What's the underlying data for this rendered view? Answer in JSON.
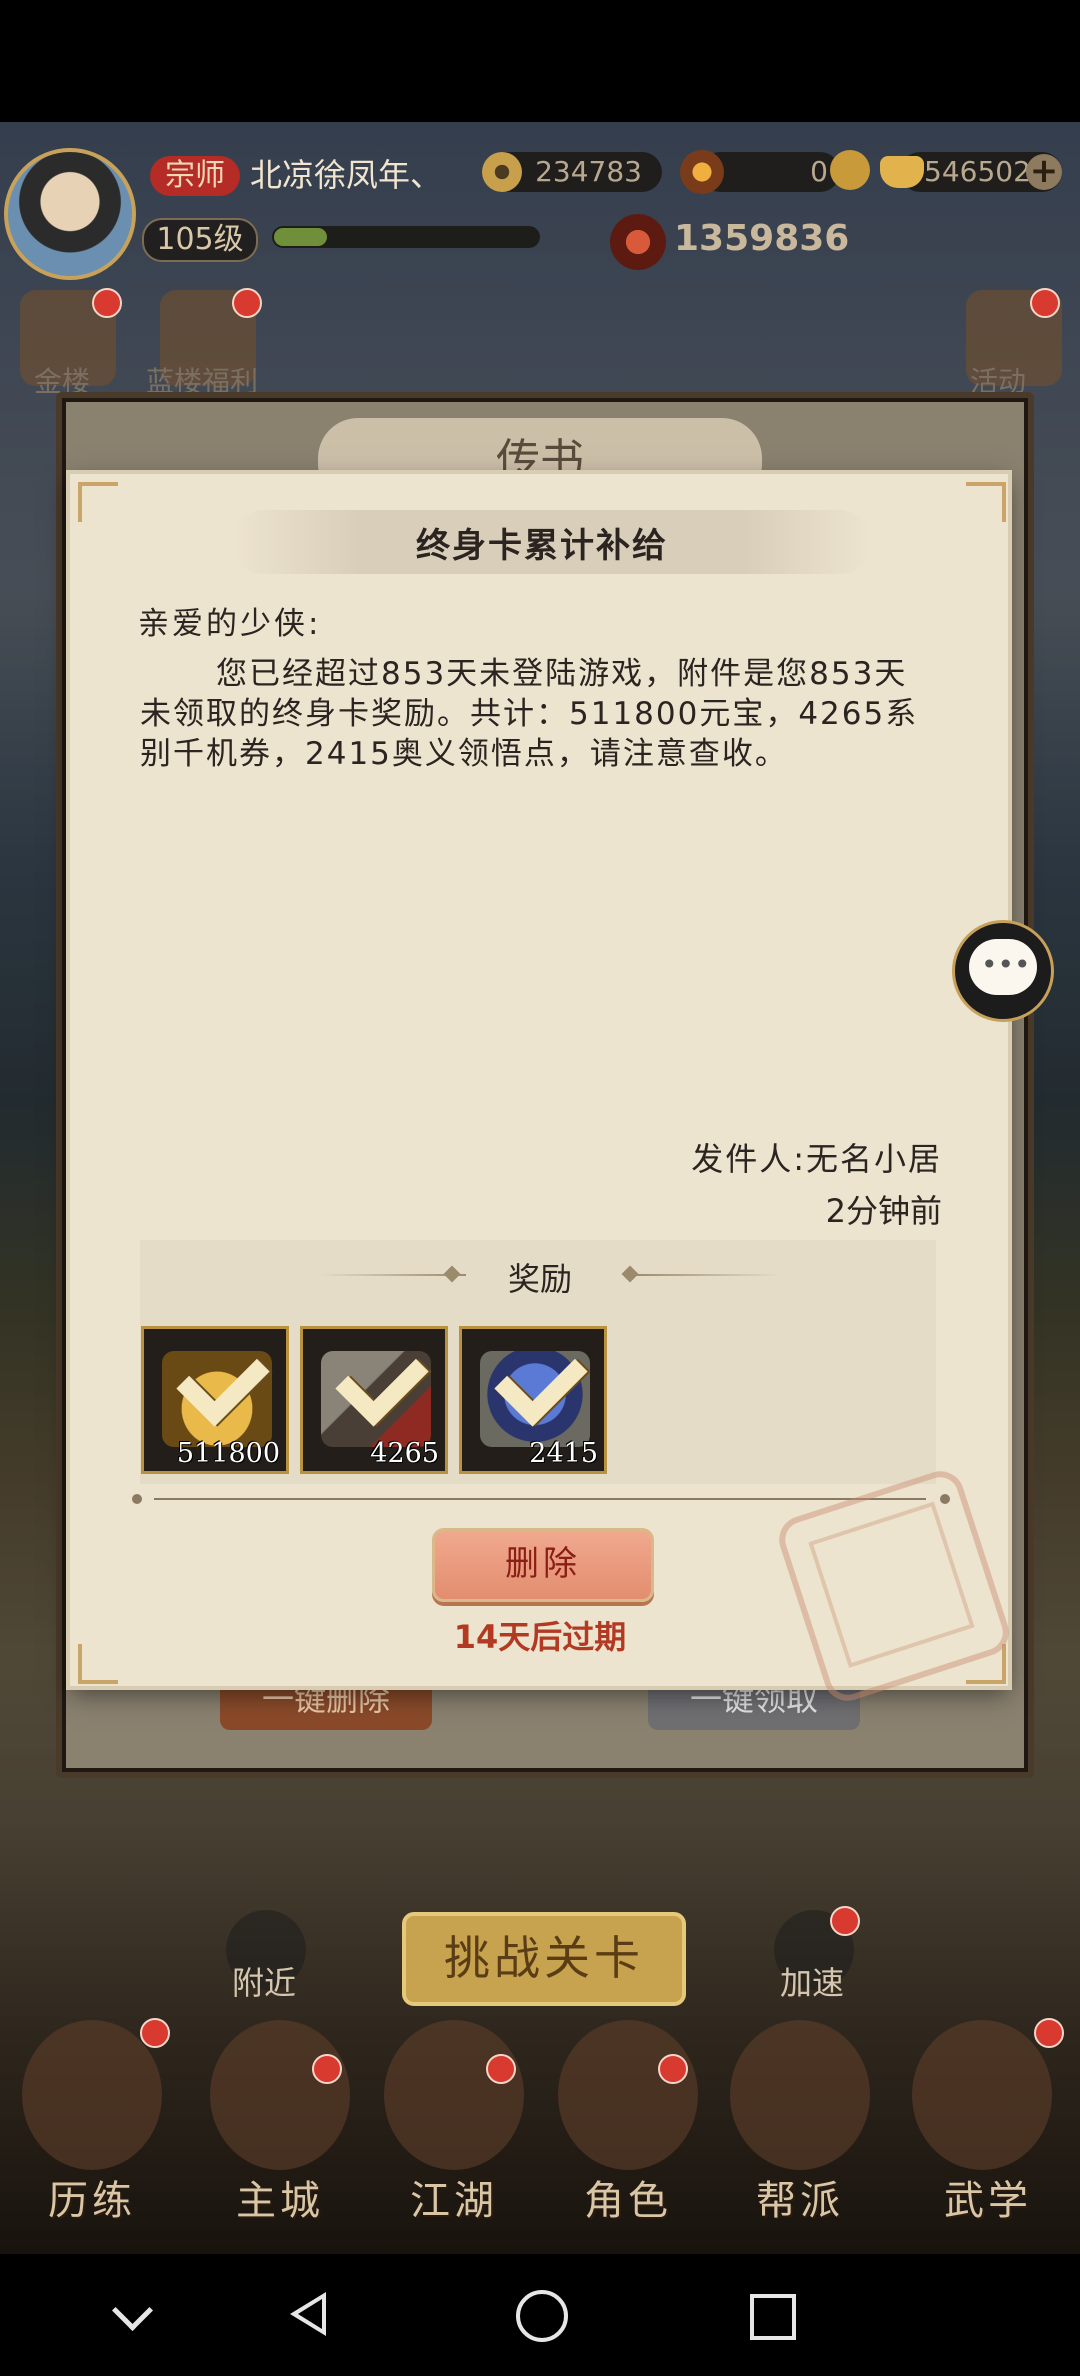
{
  "hud": {
    "rank": "宗师",
    "player_name": "北凉徐凤年、",
    "coins": "234783",
    "stamina": "0",
    "gold": "546502",
    "level": "105级",
    "exp_fraction": 0.2,
    "power": "1359836"
  },
  "side_icons": {
    "left_top_label": "金楼",
    "left_second_label": "蓝楼福利",
    "right_top_label": "活动"
  },
  "back_panel": {
    "title": "传书",
    "delete_all_label": "一键删除",
    "claim_all_label": "一键领取"
  },
  "mail": {
    "title": "终身卡累计补给",
    "greeting": "亲爱的少侠:",
    "body": "您已经超过853天未登陆游戏，附件是您853天未领取的终身卡奖励。共计：511800元宝，4265系别千机券，2415奥义领悟点，请注意查收。",
    "sender": "发件人:无名小居",
    "time_ago": "2分钟前",
    "reward_heading": "奖励",
    "rewards": [
      {
        "count": "511800",
        "icon": "gold-ingot-icon"
      },
      {
        "count": "4265",
        "icon": "ticket-book-icon"
      },
      {
        "count": "2415",
        "icon": "insight-orb-icon"
      }
    ],
    "delete_label": "删除",
    "expire_text": "14天后过期"
  },
  "game_nav": {
    "nearby_label": "附近",
    "challenge_label": "挑战关卡",
    "speedup_label": "加速",
    "tabs": [
      "历练",
      "主城",
      "江湖",
      "角色",
      "帮派",
      "武学"
    ]
  },
  "system_nav": {
    "icons": [
      "chevron-down-icon",
      "back-icon",
      "home-icon",
      "recent-apps-icon"
    ]
  }
}
